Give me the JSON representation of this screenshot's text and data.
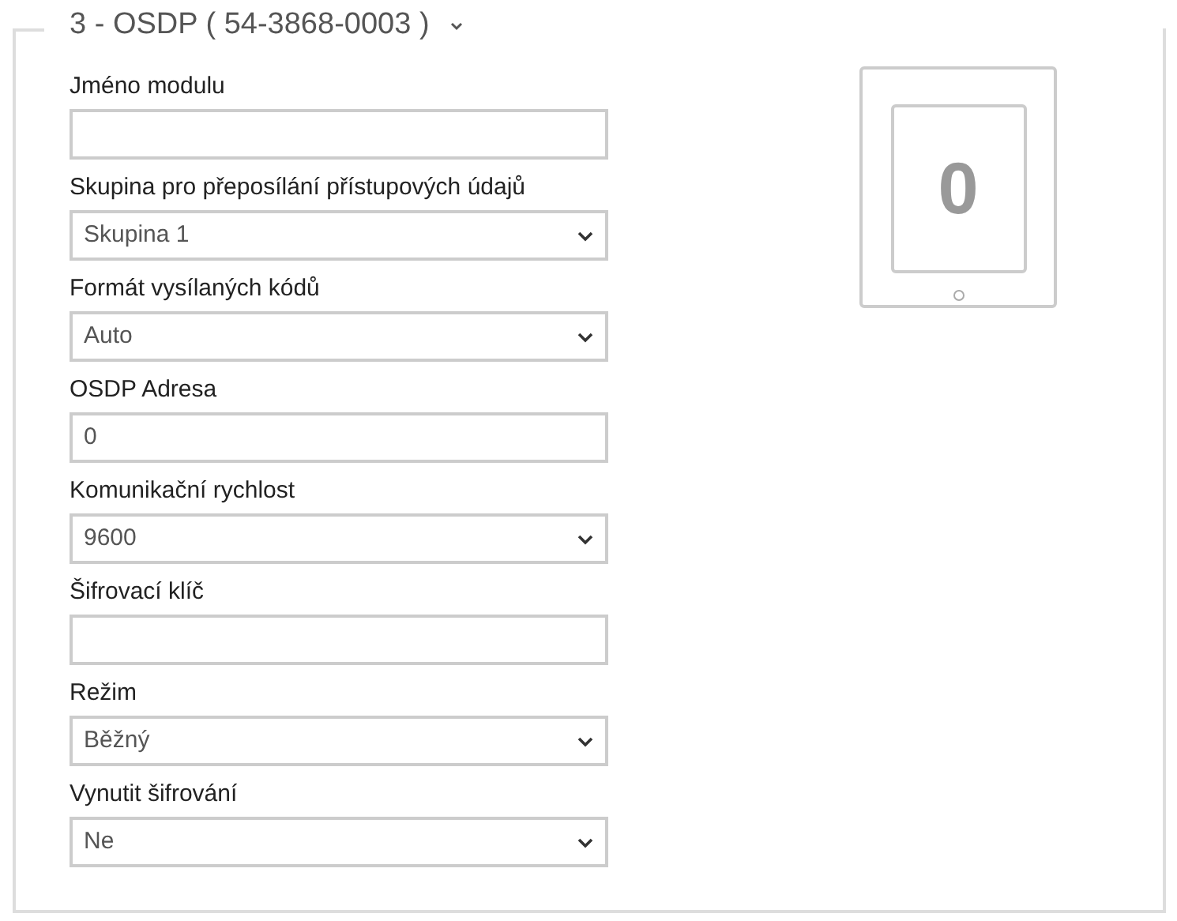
{
  "title": "3 - OSDP ( 54-3868-0003 )",
  "fields": [
    {
      "label": "Jméno modulu",
      "kind": "text"
    },
    {
      "label": "Skupina pro přeposílání přístupových údajů",
      "kind": "select",
      "value": "Skupina 1"
    },
    {
      "label": "Formát vysílaných kódů",
      "kind": "select",
      "value": "Auto"
    },
    {
      "label": "OSDP Adresa",
      "kind": "text",
      "value": "0"
    },
    {
      "label": "Komunikační rychlost",
      "kind": "select",
      "value": "9600"
    },
    {
      "label": "Šifrovací klíč",
      "kind": "text"
    },
    {
      "label": "Režim",
      "kind": "select",
      "value": "Běžný"
    },
    {
      "label": "Vynutit šifrování",
      "kind": "select",
      "value": "Ne"
    }
  ],
  "device": {
    "digit": "0"
  }
}
